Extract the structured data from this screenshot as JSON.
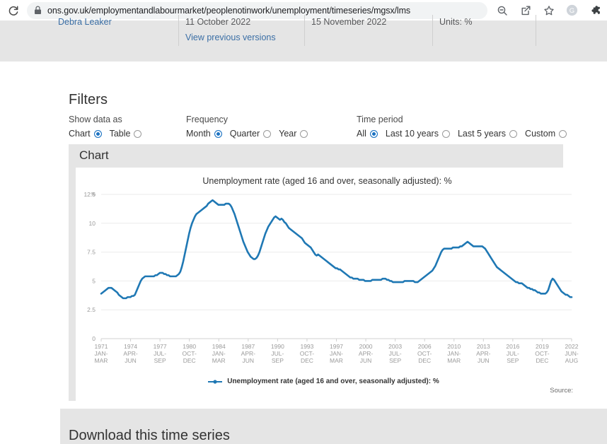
{
  "browser": {
    "reload_icon": "reload-icon",
    "lock_icon": "lock-icon",
    "url": "ons.gov.uk/employmentandlabourmarket/peoplenotinwork/unemployment/timeseries/mgsx/lms",
    "icons": [
      {
        "name": "zoom-out-icon",
        "label": "Zoom out"
      },
      {
        "name": "share-icon",
        "label": "Share this page"
      },
      {
        "name": "bookmark-star-icon",
        "label": "Bookmark this tab"
      },
      {
        "name": "google-profile-icon",
        "label": "G"
      },
      {
        "name": "extensions-puzzle-icon",
        "label": "Extensions"
      }
    ]
  },
  "metadata_strip": {
    "contact": "Debra Leaker",
    "release_date": "11 October 2022",
    "next_release": "15 November 2022",
    "units": "Units: %",
    "previous_versions_link": "View previous versions"
  },
  "filters": {
    "heading": "Filters",
    "groups": [
      {
        "label": "Show data as",
        "options": [
          {
            "label": "Chart",
            "selected": true
          },
          {
            "label": "Table",
            "selected": false
          }
        ]
      },
      {
        "label": "Frequency",
        "options": [
          {
            "label": "Month",
            "selected": true
          },
          {
            "label": "Quarter",
            "selected": false
          },
          {
            "label": "Year",
            "selected": false
          }
        ]
      },
      {
        "label": "Time period",
        "options": [
          {
            "label": "All",
            "selected": true
          },
          {
            "label": "Last 10 years",
            "selected": false
          },
          {
            "label": "Last 5 years",
            "selected": false
          },
          {
            "label": "Custom",
            "selected": false
          }
        ]
      }
    ]
  },
  "chart_panel": {
    "heading": "Chart",
    "source_label": "Source:"
  },
  "download_section": {
    "heading": "Download this time series"
  },
  "colors": {
    "series_blue": "#1f78b4",
    "radio_blue": "#1b72c2",
    "panel_gray": "#e5e5e5",
    "link_blue": "#3a6ea5",
    "axis_text": "#9a9a9a",
    "grid": "#ebebeb"
  },
  "chart_data": {
    "type": "line",
    "title": "Unemployment rate (aged 16 and over, seasonally adjusted): %",
    "xlabel": "",
    "ylabel": "%",
    "ylim": [
      0,
      12.5
    ],
    "yticks": [
      0,
      2.5,
      5,
      7.5,
      10,
      12.5
    ],
    "ytick_labels": [
      "0",
      "2.5",
      "5",
      "7.5",
      "10",
      "12.5"
    ],
    "grid": true,
    "legend_position": "bottom",
    "legend": [
      "Unemployment rate (aged 16 and over, seasonally adjusted): %"
    ],
    "series": [
      {
        "name": "Unemployment rate (aged 16 and over, seasonally adjusted): %",
        "color": "#1f78b4",
        "values": [
          3.9,
          4.0,
          4.1,
          4.2,
          4.3,
          4.4,
          4.4,
          4.4,
          4.3,
          4.2,
          4.1,
          4.0,
          3.8,
          3.7,
          3.6,
          3.5,
          3.5,
          3.5,
          3.6,
          3.6,
          3.6,
          3.7,
          3.7,
          3.8,
          4.1,
          4.4,
          4.7,
          5.0,
          5.2,
          5.3,
          5.4,
          5.4,
          5.4,
          5.4,
          5.4,
          5.4,
          5.4,
          5.5,
          5.5,
          5.6,
          5.7,
          5.7,
          5.7,
          5.6,
          5.6,
          5.5,
          5.5,
          5.4,
          5.4,
          5.4,
          5.4,
          5.4,
          5.5,
          5.6,
          5.8,
          6.2,
          6.7,
          7.3,
          7.9,
          8.5,
          9.1,
          9.6,
          10.0,
          10.3,
          10.6,
          10.8,
          10.9,
          11.0,
          11.1,
          11.2,
          11.3,
          11.4,
          11.5,
          11.7,
          11.8,
          11.9,
          12.0,
          11.9,
          11.8,
          11.7,
          11.6,
          11.6,
          11.6,
          11.6,
          11.6,
          11.7,
          11.7,
          11.7,
          11.6,
          11.4,
          11.1,
          10.8,
          10.4,
          10.0,
          9.6,
          9.2,
          8.8,
          8.4,
          8.1,
          7.8,
          7.5,
          7.3,
          7.1,
          7.0,
          6.9,
          6.9,
          7.0,
          7.2,
          7.5,
          7.9,
          8.3,
          8.7,
          9.1,
          9.4,
          9.7,
          9.9,
          10.1,
          10.3,
          10.5,
          10.6,
          10.5,
          10.4,
          10.3,
          10.4,
          10.3,
          10.1,
          10.0,
          9.8,
          9.6,
          9.5,
          9.4,
          9.3,
          9.2,
          9.1,
          9.0,
          8.9,
          8.8,
          8.7,
          8.5,
          8.3,
          8.2,
          8.1,
          8.0,
          7.9,
          7.7,
          7.5,
          7.3,
          7.2,
          7.3,
          7.2,
          7.1,
          7.0,
          6.9,
          6.8,
          6.7,
          6.6,
          6.5,
          6.4,
          6.3,
          6.2,
          6.1,
          6.1,
          6.0,
          6.0,
          5.9,
          5.8,
          5.7,
          5.6,
          5.5,
          5.4,
          5.3,
          5.3,
          5.2,
          5.2,
          5.2,
          5.2,
          5.1,
          5.1,
          5.1,
          5.1,
          5.0,
          5.0,
          5.0,
          5.0,
          5.0,
          5.1,
          5.1,
          5.1,
          5.1,
          5.1,
          5.1,
          5.1,
          5.2,
          5.2,
          5.2,
          5.1,
          5.1,
          5.0,
          5.0,
          4.9,
          4.9,
          4.9,
          4.9,
          4.9,
          4.9,
          4.9,
          4.9,
          5.0,
          5.0,
          5.0,
          5.0,
          5.0,
          5.0,
          5.0,
          4.9,
          4.9,
          4.9,
          5.0,
          5.1,
          5.2,
          5.3,
          5.4,
          5.5,
          5.6,
          5.7,
          5.8,
          5.9,
          6.1,
          6.3,
          6.6,
          6.9,
          7.2,
          7.5,
          7.7,
          7.8,
          7.8,
          7.8,
          7.8,
          7.8,
          7.8,
          7.9,
          7.9,
          7.9,
          7.9,
          7.9,
          8.0,
          8.0,
          8.1,
          8.2,
          8.3,
          8.4,
          8.3,
          8.2,
          8.1,
          8.0,
          8.0,
          8.0,
          8.0,
          8.0,
          8.0,
          8.0,
          7.9,
          7.8,
          7.6,
          7.4,
          7.2,
          7.0,
          6.8,
          6.6,
          6.4,
          6.2,
          6.1,
          6.0,
          5.9,
          5.8,
          5.7,
          5.6,
          5.5,
          5.4,
          5.3,
          5.2,
          5.1,
          5.0,
          4.9,
          4.9,
          4.8,
          4.8,
          4.8,
          4.7,
          4.6,
          4.5,
          4.4,
          4.4,
          4.3,
          4.3,
          4.2,
          4.2,
          4.1,
          4.0,
          4.0,
          3.9,
          3.9,
          3.9,
          3.9,
          4.0,
          4.2,
          4.6,
          5.0,
          5.2,
          5.1,
          4.9,
          4.7,
          4.5,
          4.3,
          4.1,
          4.0,
          3.9,
          3.8,
          3.8,
          3.7,
          3.6,
          3.6
        ],
        "start_label": "1971 JAN-MAR",
        "end_label": "2022 JUN-AUG"
      }
    ],
    "xtick_labels": [
      [
        "1971",
        "JAN-",
        "MAR"
      ],
      [
        "1974",
        "APR-",
        "JUN"
      ],
      [
        "1977",
        "JUL-",
        "SEP"
      ],
      [
        "1980",
        "OCT-",
        "DEC"
      ],
      [
        "1984",
        "JAN-",
        "MAR"
      ],
      [
        "1987",
        "APR-",
        "JUN"
      ],
      [
        "1990",
        "JUL-",
        "SEP"
      ],
      [
        "1993",
        "OCT-",
        "DEC"
      ],
      [
        "1997",
        "JAN-",
        "MAR"
      ],
      [
        "2000",
        "APR-",
        "JUN"
      ],
      [
        "2003",
        "JUL-",
        "SEP"
      ],
      [
        "2006",
        "OCT-",
        "DEC"
      ],
      [
        "2010",
        "JAN-",
        "MAR"
      ],
      [
        "2013",
        "APR-",
        "JUN"
      ],
      [
        "2016",
        "JUL-",
        "SEP"
      ],
      [
        "2019",
        "OCT-",
        "DEC"
      ],
      [
        "2022",
        "JUN-",
        "AUG"
      ]
    ]
  }
}
